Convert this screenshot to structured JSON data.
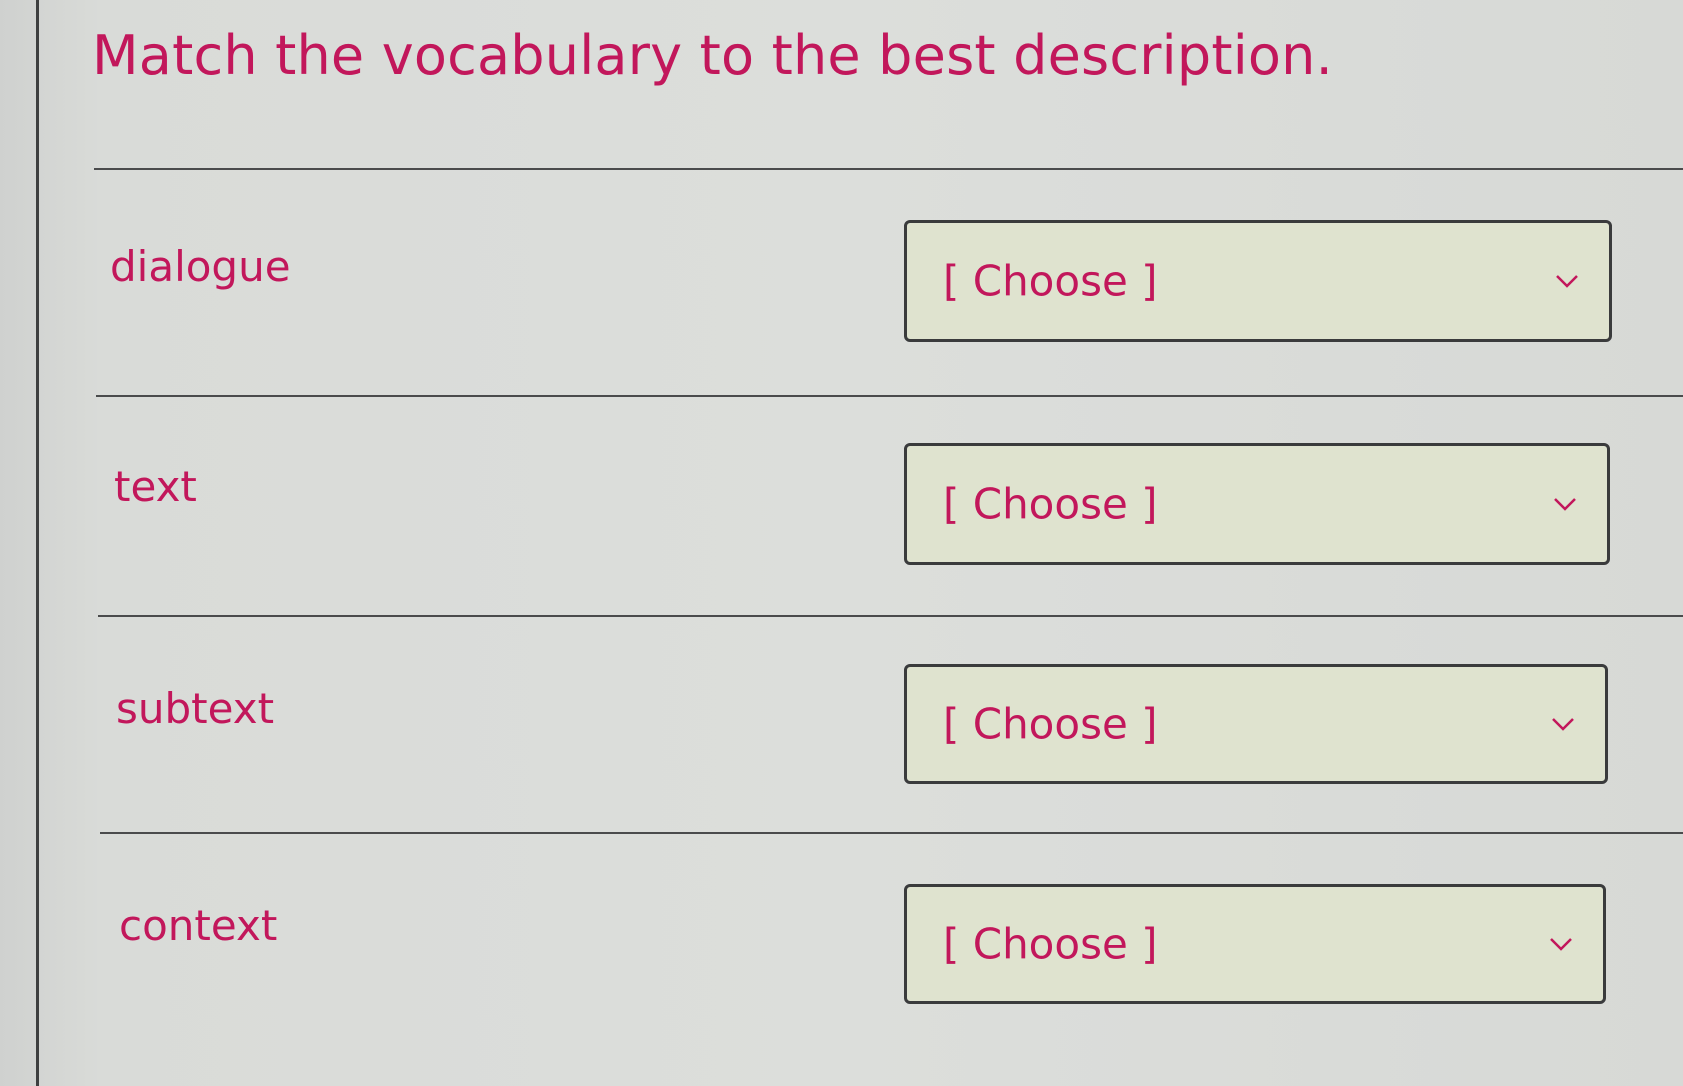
{
  "question": {
    "title": "Match the vocabulary to the best description."
  },
  "rows": [
    {
      "term": "dialogue",
      "select_value": "[ Choose ]",
      "icon": "chevron-down-icon"
    },
    {
      "term": "text",
      "select_value": "[ Choose ]",
      "icon": "chevron-down-icon"
    },
    {
      "term": "subtext",
      "select_value": "[ Choose ]",
      "icon": "chevron-down-icon"
    },
    {
      "term": "context",
      "select_value": "[ Choose ]",
      "icon": "chevron-down-icon"
    }
  ],
  "colors": {
    "accent_text": "#c2175b",
    "select_background": "#dfe3cf",
    "border": "#3a3b3c"
  }
}
